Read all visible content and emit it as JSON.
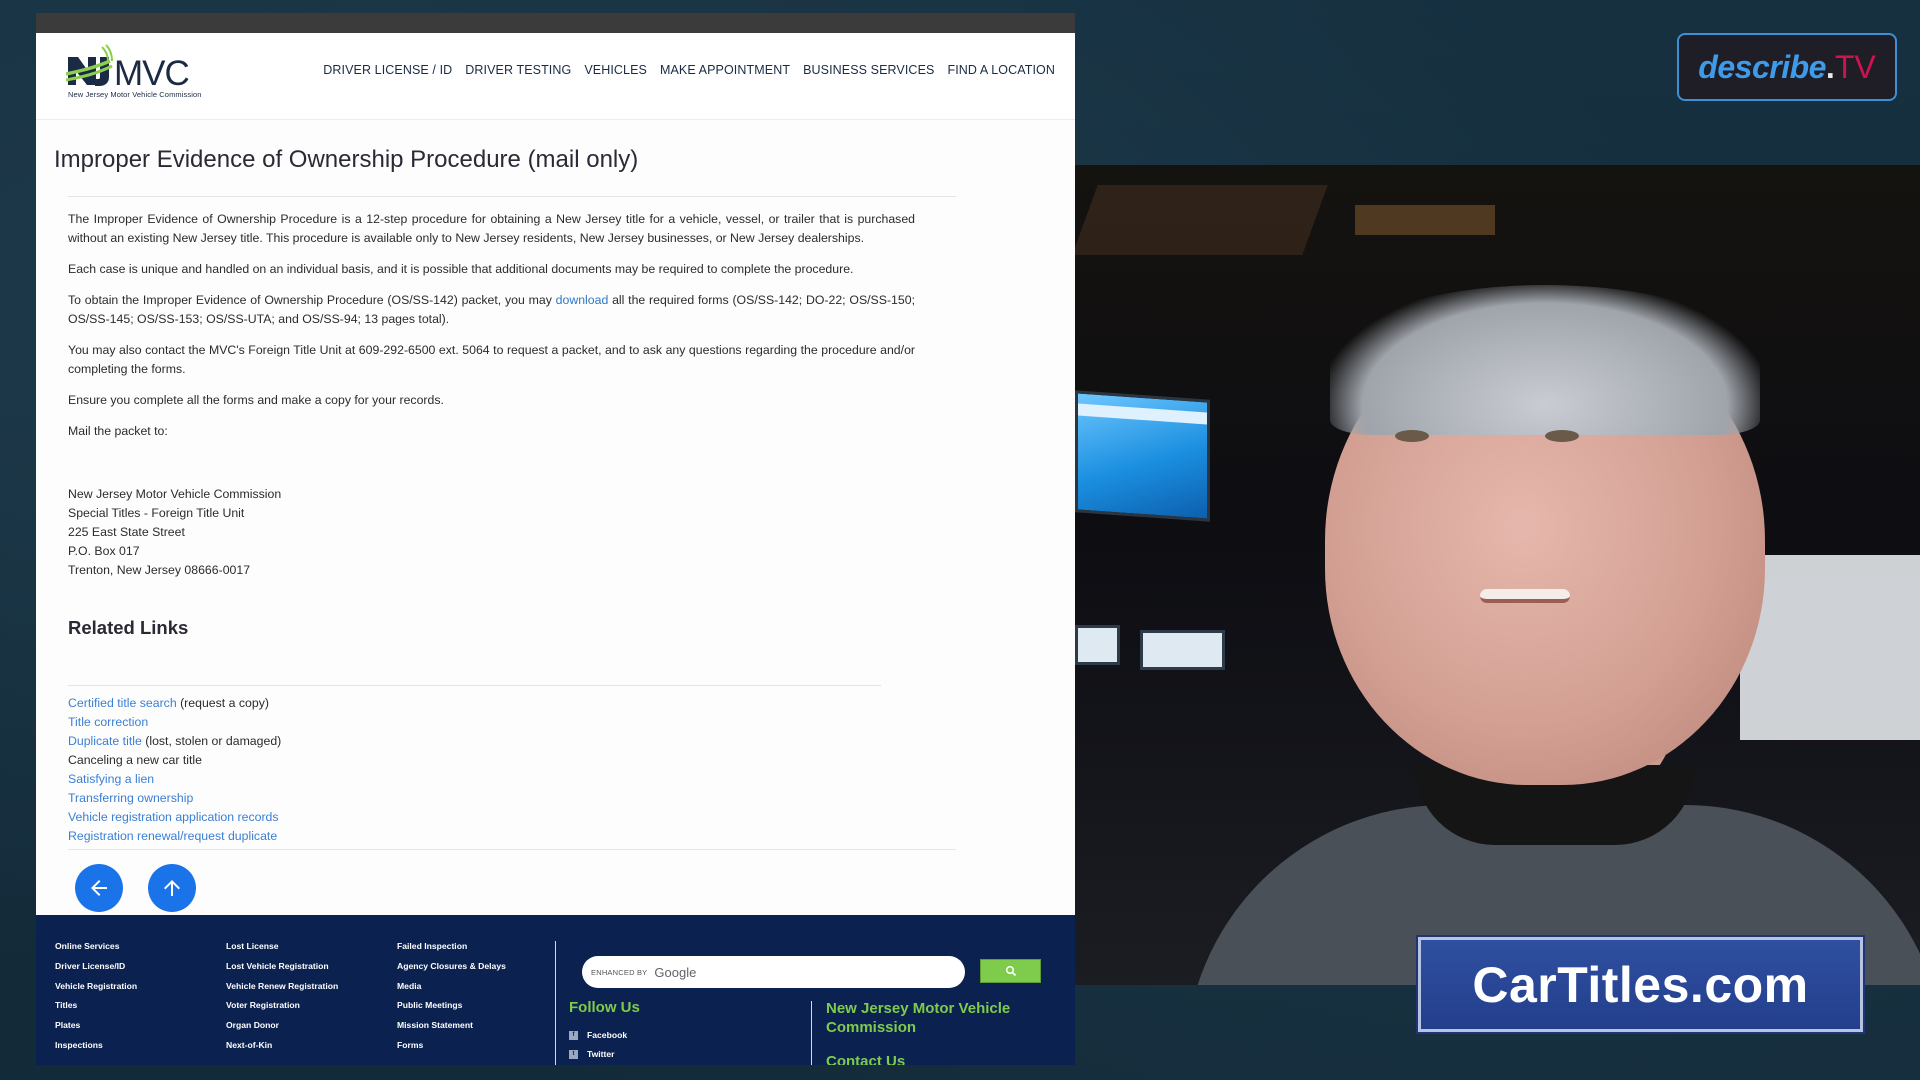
{
  "browser": {
    "logo": {
      "wordmark": "MVC",
      "tagline": "New Jersey Motor Vehicle Commission",
      "colors": {
        "navy": "#1b2b45",
        "green": "#7fcb4c"
      }
    },
    "nav": [
      {
        "label": "DRIVER LICENSE / ID"
      },
      {
        "label": "DRIVER TESTING"
      },
      {
        "label": "VEHICLES"
      },
      {
        "label": "MAKE APPOINTMENT"
      },
      {
        "label": "BUSINESS SERVICES"
      },
      {
        "label": "FIND A LOCATION"
      }
    ],
    "page_title": "Improper Evidence of Ownership Procedure (mail only)",
    "paragraphs": {
      "p1": "The Improper Evidence of Ownership Procedure is a 12-step procedure for obtaining a New Jersey title for a vehicle, vessel, or trailer that is purchased without an existing New Jersey title.  This procedure is available only to New Jersey residents, New Jersey businesses, or New Jersey dealerships.",
      "p2": "Each case is unique and handled on an individual basis, and it is possible that additional documents may be required to complete the procedure.",
      "p3_before": "To obtain the Improper Evidence of Ownership Procedure (OS/SS-142) packet, you may ",
      "p3_link": "download",
      "p3_after": " all the required forms (OS/SS-142; DO-22; OS/SS-150; OS/SS-145; OS/SS-153; OS/SS-UTA; and OS/SS-94; 13 pages total).",
      "p4": "You may also contact the MVC's Foreign Title Unit at 609-292-6500 ext. 5064 to request a packet, and to ask any questions regarding the procedure and/or completing the forms.",
      "p5": "Ensure you complete all the forms and make a copy for your records.",
      "p6": "Mail the packet to:"
    },
    "address": [
      "New Jersey Motor Vehicle Commission",
      "Special Titles - Foreign Title Unit",
      "225 East State Street",
      "P.O. Box 017",
      "Trenton, New Jersey 08666-0017"
    ],
    "related": {
      "title": "Related Links",
      "links": [
        {
          "link": "Certified title search",
          "suffix": " (request a copy)"
        },
        {
          "link": "Title correction",
          "suffix": ""
        },
        {
          "link": "Duplicate title",
          "suffix": " (lost, stolen or damaged)"
        },
        {
          "link": "",
          "suffix": "Canceling a new car title"
        },
        {
          "link": "Satisfying a lien",
          "suffix": ""
        },
        {
          "link": "Transferring ownership",
          "suffix": ""
        },
        {
          "link": "Vehicle registration application records",
          "suffix": ""
        },
        {
          "link": "Registration renewal/request duplicate",
          "suffix": ""
        }
      ]
    },
    "buttons": {
      "back_icon": "arrow-left-icon",
      "top_icon": "arrow-up-icon",
      "color": "#1a73e8"
    },
    "footer": {
      "col1": [
        "Online Services",
        "Driver License/ID",
        "Vehicle Registration",
        "Titles",
        "Plates",
        "Inspections"
      ],
      "col2": [
        "Lost License",
        "Lost Vehicle Registration",
        "Vehicle Renew Registration",
        "Voter Registration",
        "Organ Donor",
        "Next-of-Kin"
      ],
      "col3": [
        "Failed Inspection",
        "Agency Closures & Delays",
        "Media",
        "Public Meetings",
        "Mission Statement",
        "Forms"
      ],
      "search": {
        "enhanced_label": "ENHANCED BY",
        "brand": "Google",
        "button_icon": "search-icon"
      },
      "follow_title": "Follow Us",
      "social": [
        {
          "icon": "facebook-icon",
          "glyph": "f",
          "label": "Facebook"
        },
        {
          "icon": "twitter-icon",
          "glyph": "t",
          "label": "Twitter"
        }
      ],
      "org_title": "New Jersey Motor Vehicle Commission",
      "contact_title": "Contact Us",
      "colors": {
        "background": "#0b2250",
        "accent": "#7fcb4c"
      }
    }
  },
  "overlays": {
    "describe_tv": {
      "part1": "describe",
      "dot": ".",
      "part2": "TV",
      "colors": {
        "blue": "#3d9be9",
        "red": "#d0124f"
      }
    },
    "cartitles": {
      "text": "CarTitles.com"
    }
  }
}
